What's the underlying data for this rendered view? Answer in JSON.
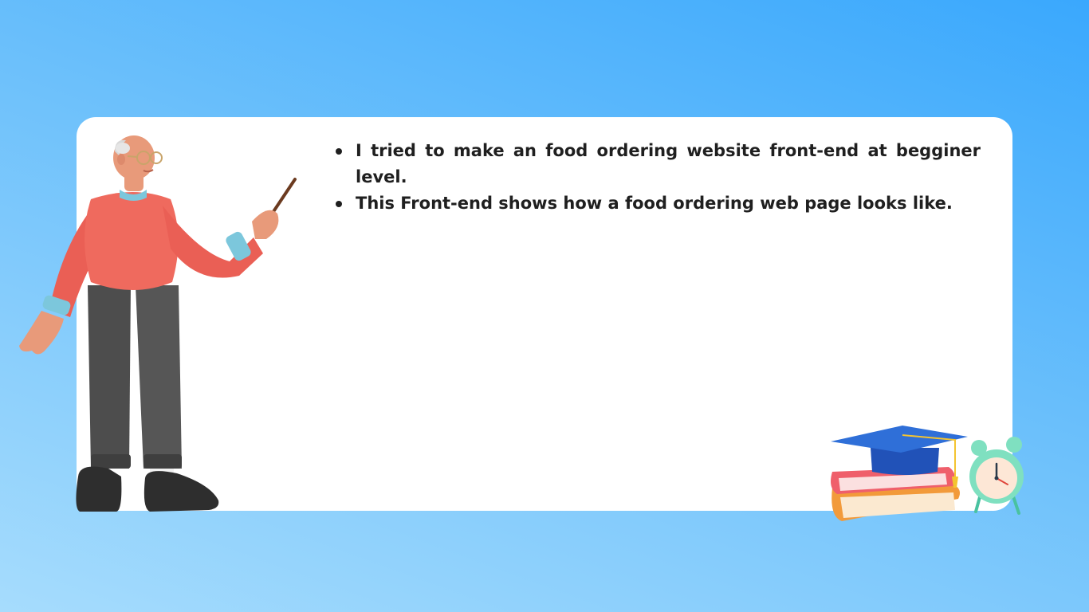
{
  "slide": {
    "bullets": [
      "I tried to make an food ordering website front-end at begginer level.",
      "This Front-end shows how a food ordering web page looks like."
    ]
  },
  "illustrations": {
    "presenter": "teacher-with-pointer-icon",
    "decoration": "graduation-books-clock-icon"
  },
  "colors": {
    "background_top": "#3aa8fd",
    "background_bottom": "#a6dcfd",
    "card": "#ffffff",
    "text": "#1f1f1f",
    "sweater": "#ef6a5e",
    "trousers": "#4a4a4a",
    "cap": "#2f6fd8",
    "clock": "#7fe0c0"
  }
}
